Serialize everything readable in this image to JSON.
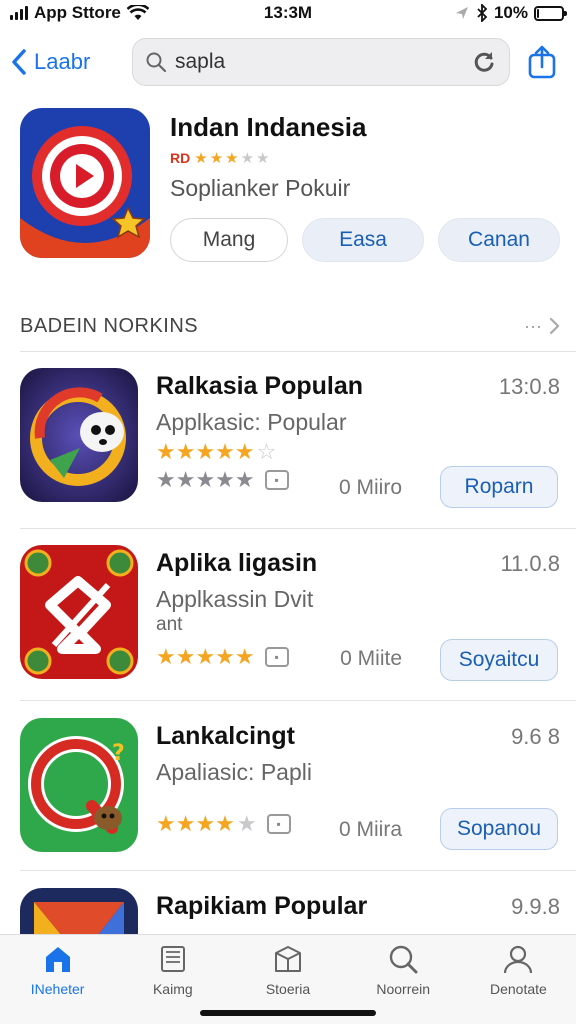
{
  "status": {
    "carrier": "App Sttore",
    "time": "13:3M",
    "battery": "10%",
    "battery_level": 0.1
  },
  "nav": {
    "back_label": "Laabr",
    "search_value": "sapla",
    "icons": [
      "chevron-left-icon",
      "search-icon",
      "refresh-icon",
      "share-icon"
    ]
  },
  "featured": {
    "title": "Indan Indanesia",
    "rating_code": "RD",
    "stars": 3,
    "subtitle": "Soplianker Pokuir",
    "buttons": [
      "Mang",
      "Easa",
      "Canan"
    ]
  },
  "section": {
    "title": "BADEIN NORKINS",
    "more": "···"
  },
  "apps": [
    {
      "name": "Ralkasia Populan",
      "subtitle": "Applkasic: Popular",
      "subtitle2": "",
      "version": "13:0.8",
      "stars_colored": 5,
      "stars_second_row": 5,
      "size": "0 Miiro",
      "button": "Roparn",
      "colors": [
        "#2a2a6e",
        "#f2b01e"
      ]
    },
    {
      "name": "Aplika ligasin",
      "subtitle": "Applkassin Dvit",
      "subtitle2": "ant",
      "version": "11.0.8",
      "stars_colored": 5,
      "size": "0 Miite",
      "button": "Soyaitcu",
      "colors": [
        "#c41818",
        "#ffffff"
      ]
    },
    {
      "name": "Lankalcingt",
      "subtitle": "Apaliasic: Papli",
      "subtitle2": "",
      "version": "9.6 8",
      "stars_colored": 4,
      "size": "0 Miira",
      "button": "Sopanou",
      "colors": [
        "#2ea84a",
        "#d62b23"
      ]
    },
    {
      "name": "Rapikiam Popular",
      "subtitle": "",
      "subtitle2": "",
      "version": "9.9.8",
      "colors": [
        "#1d2a5e",
        "#e04b2a"
      ]
    }
  ],
  "tabs": [
    {
      "label": "INeheter",
      "icon": "home-icon",
      "active": true
    },
    {
      "label": "Kaimg",
      "icon": "book-icon",
      "active": false
    },
    {
      "label": "Stoeria",
      "icon": "store-icon",
      "active": false
    },
    {
      "label": "Noorrein",
      "icon": "search-icon",
      "active": false
    },
    {
      "label": "Denotate",
      "icon": "person-icon",
      "active": false
    }
  ]
}
